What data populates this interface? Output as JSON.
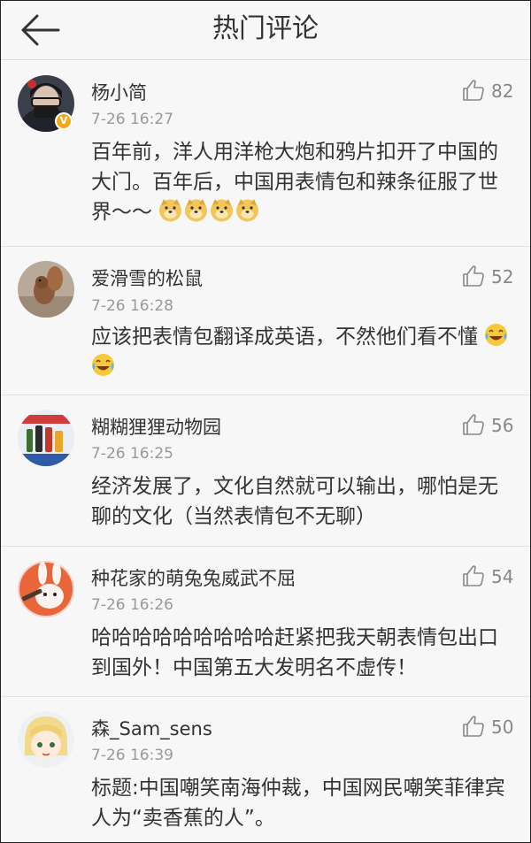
{
  "header": {
    "title": "热门评论",
    "back_icon": "back-arrow-icon"
  },
  "comments": [
    {
      "username": "杨小简",
      "time": "7-26 16:27",
      "likes": "82",
      "verified": true,
      "text": "百年前，洋人用洋枪大炮和鸦片扣开了中国的大门。百年后，中国用表情包和辣条征服了世界～～",
      "emojis": [
        "doge-emoji",
        "doge-emoji",
        "doge-emoji",
        "doge-emoji"
      ]
    },
    {
      "username": "爱滑雪的松鼠",
      "time": "7-26 16:28",
      "likes": "52",
      "verified": false,
      "text": "应该把表情包翻译成英语，不然他们看不懂",
      "emojis": [
        "laugh-cry-emoji",
        "laugh-cry-emoji"
      ]
    },
    {
      "username": "糊糊狸狸动物园",
      "time": "7-26 16:25",
      "likes": "56",
      "verified": false,
      "text": "经济发展了，文化自然就可以输出，哪怕是无聊的文化（当然表情包不无聊）",
      "emojis": []
    },
    {
      "username": "种花家的萌兔兔威武不屈",
      "time": "7-26 16:26",
      "likes": "54",
      "verified": false,
      "text": "哈哈哈哈哈哈哈哈哈赶紧把我天朝表情包出口到国外！中国第五大发明名不虚传！",
      "emojis": []
    },
    {
      "username": "森_Sam_sens",
      "time": "7-26 16:39",
      "likes": "50",
      "verified": false,
      "text": "标题:中国嘲笑南海仲裁，中国网民嘲笑菲律宾人为“卖香蕉的人”。",
      "emojis": []
    }
  ]
}
